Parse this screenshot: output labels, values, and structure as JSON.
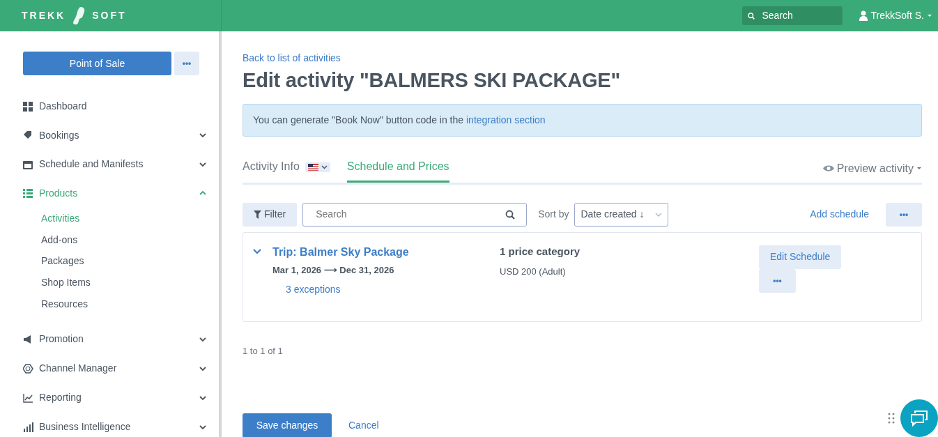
{
  "header": {
    "logo_left": "TREKK",
    "logo_right": "SOFT",
    "search": {
      "placeholder": "Search"
    },
    "user": "TrekkSoft S."
  },
  "sidebar": {
    "primary_button": "Point of Sale",
    "more_button": "•••",
    "items": [
      {
        "kind": "link",
        "label": "Dashboard",
        "selected": false
      },
      {
        "kind": "group",
        "label": "Bookings",
        "expanded": false,
        "selected": false
      },
      {
        "kind": "group",
        "label": "Schedule and Manifests",
        "expanded": false,
        "selected": false
      },
      {
        "kind": "group",
        "label": "Products",
        "expanded": true,
        "selected": true,
        "children": [
          {
            "label": "Activities",
            "selected": true
          },
          {
            "label": "Add-ons",
            "selected": false
          },
          {
            "label": "Packages",
            "selected": false
          },
          {
            "label": "Shop Items",
            "selected": false
          },
          {
            "label": "Resources",
            "selected": false
          }
        ]
      },
      {
        "kind": "group",
        "label": "Promotion",
        "expanded": false,
        "selected": false
      },
      {
        "kind": "group",
        "label": "Channel Manager",
        "expanded": false,
        "selected": false
      },
      {
        "kind": "group",
        "label": "Reporting",
        "expanded": false,
        "selected": false
      },
      {
        "kind": "group",
        "label": "Business Intelligence",
        "expanded": false,
        "selected": false
      }
    ]
  },
  "main": {
    "back_link": "Back to list of activities",
    "title": "Edit activity \"BALMERS SKI PACKAGE\"",
    "alert": {
      "text": "You can generate \"Book Now\" button code in the",
      "link": "integration section"
    },
    "tabs": [
      {
        "label": "Activity Info",
        "selected": false,
        "kind": "language"
      },
      {
        "label": "Schedule and Prices",
        "selected": true,
        "kind": "plain"
      }
    ],
    "preview": "Preview activity",
    "toolbar": {
      "filter": "Filter",
      "search": {
        "placeholder": "Search"
      },
      "sort_label": "Sort by",
      "sort_value": "Date created ↓",
      "add": "Add schedule",
      "more": "•••"
    },
    "schedules": [
      {
        "title": "Trip: Balmer Sky Package",
        "expanded": true,
        "dates": "Mar 1, 2026 ⟶ Dec 31, 2026",
        "exceptions": "3 exceptions",
        "price_title": "1 price category",
        "price": "USD 200 (Adult)",
        "edit": "Edit Schedule",
        "more": "•••"
      }
    ],
    "pagination": "1 to 1 of 1",
    "save": "Save changes",
    "cancel": "Cancel"
  }
}
